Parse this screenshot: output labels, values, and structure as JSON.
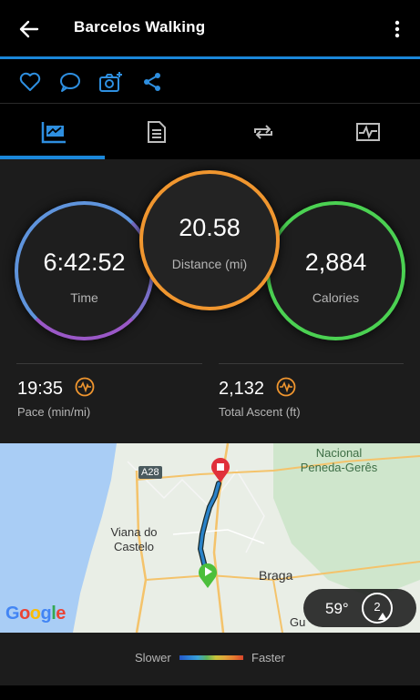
{
  "header": {
    "title": "Barcelos Walking",
    "back_icon": "arrow-left-icon",
    "menu_icon": "more-vert-icon"
  },
  "actions": [
    {
      "name": "like-button",
      "icon": "heart-icon"
    },
    {
      "name": "comment-button",
      "icon": "comment-icon"
    },
    {
      "name": "add-photo-button",
      "icon": "camera-plus-icon"
    },
    {
      "name": "share-button",
      "icon": "share-icon"
    }
  ],
  "tabs": [
    {
      "name": "tab-summary",
      "icon": "chart-flag-icon",
      "active": true
    },
    {
      "name": "tab-details",
      "icon": "document-icon",
      "active": false
    },
    {
      "name": "tab-laps",
      "icon": "loop-icon",
      "active": false
    },
    {
      "name": "tab-graphs",
      "icon": "pulse-chart-icon",
      "active": false
    }
  ],
  "rings": {
    "time": {
      "value": "6:42:52",
      "label": "Time"
    },
    "distance": {
      "value": "20.58",
      "label": "Distance (mi)"
    },
    "calories": {
      "value": "2,884",
      "label": "Calories"
    }
  },
  "metrics": {
    "pace": {
      "value": "19:35",
      "label": "Pace (min/mi)",
      "icon": "pulse-icon"
    },
    "ascent": {
      "value": "2,132",
      "label": "Total Ascent (ft)",
      "icon": "pulse-icon"
    }
  },
  "map": {
    "labels": {
      "a28": "A28",
      "viana": "Viana do\nCastelo",
      "braga": "Braga",
      "gu": "Gu",
      "park": "Nacional\nPeneda-Gerês"
    },
    "brand": "Google",
    "weather": {
      "temp": "59°",
      "wind": "2"
    }
  },
  "legend": {
    "slower": "Slower",
    "faster": "Faster"
  },
  "colors": {
    "accent": "#1b87d9",
    "time_ring": "#7a6fc9",
    "distance_ring": "#f0962f",
    "calories_ring": "#4bd152",
    "metric_icon": "#f0962f"
  }
}
